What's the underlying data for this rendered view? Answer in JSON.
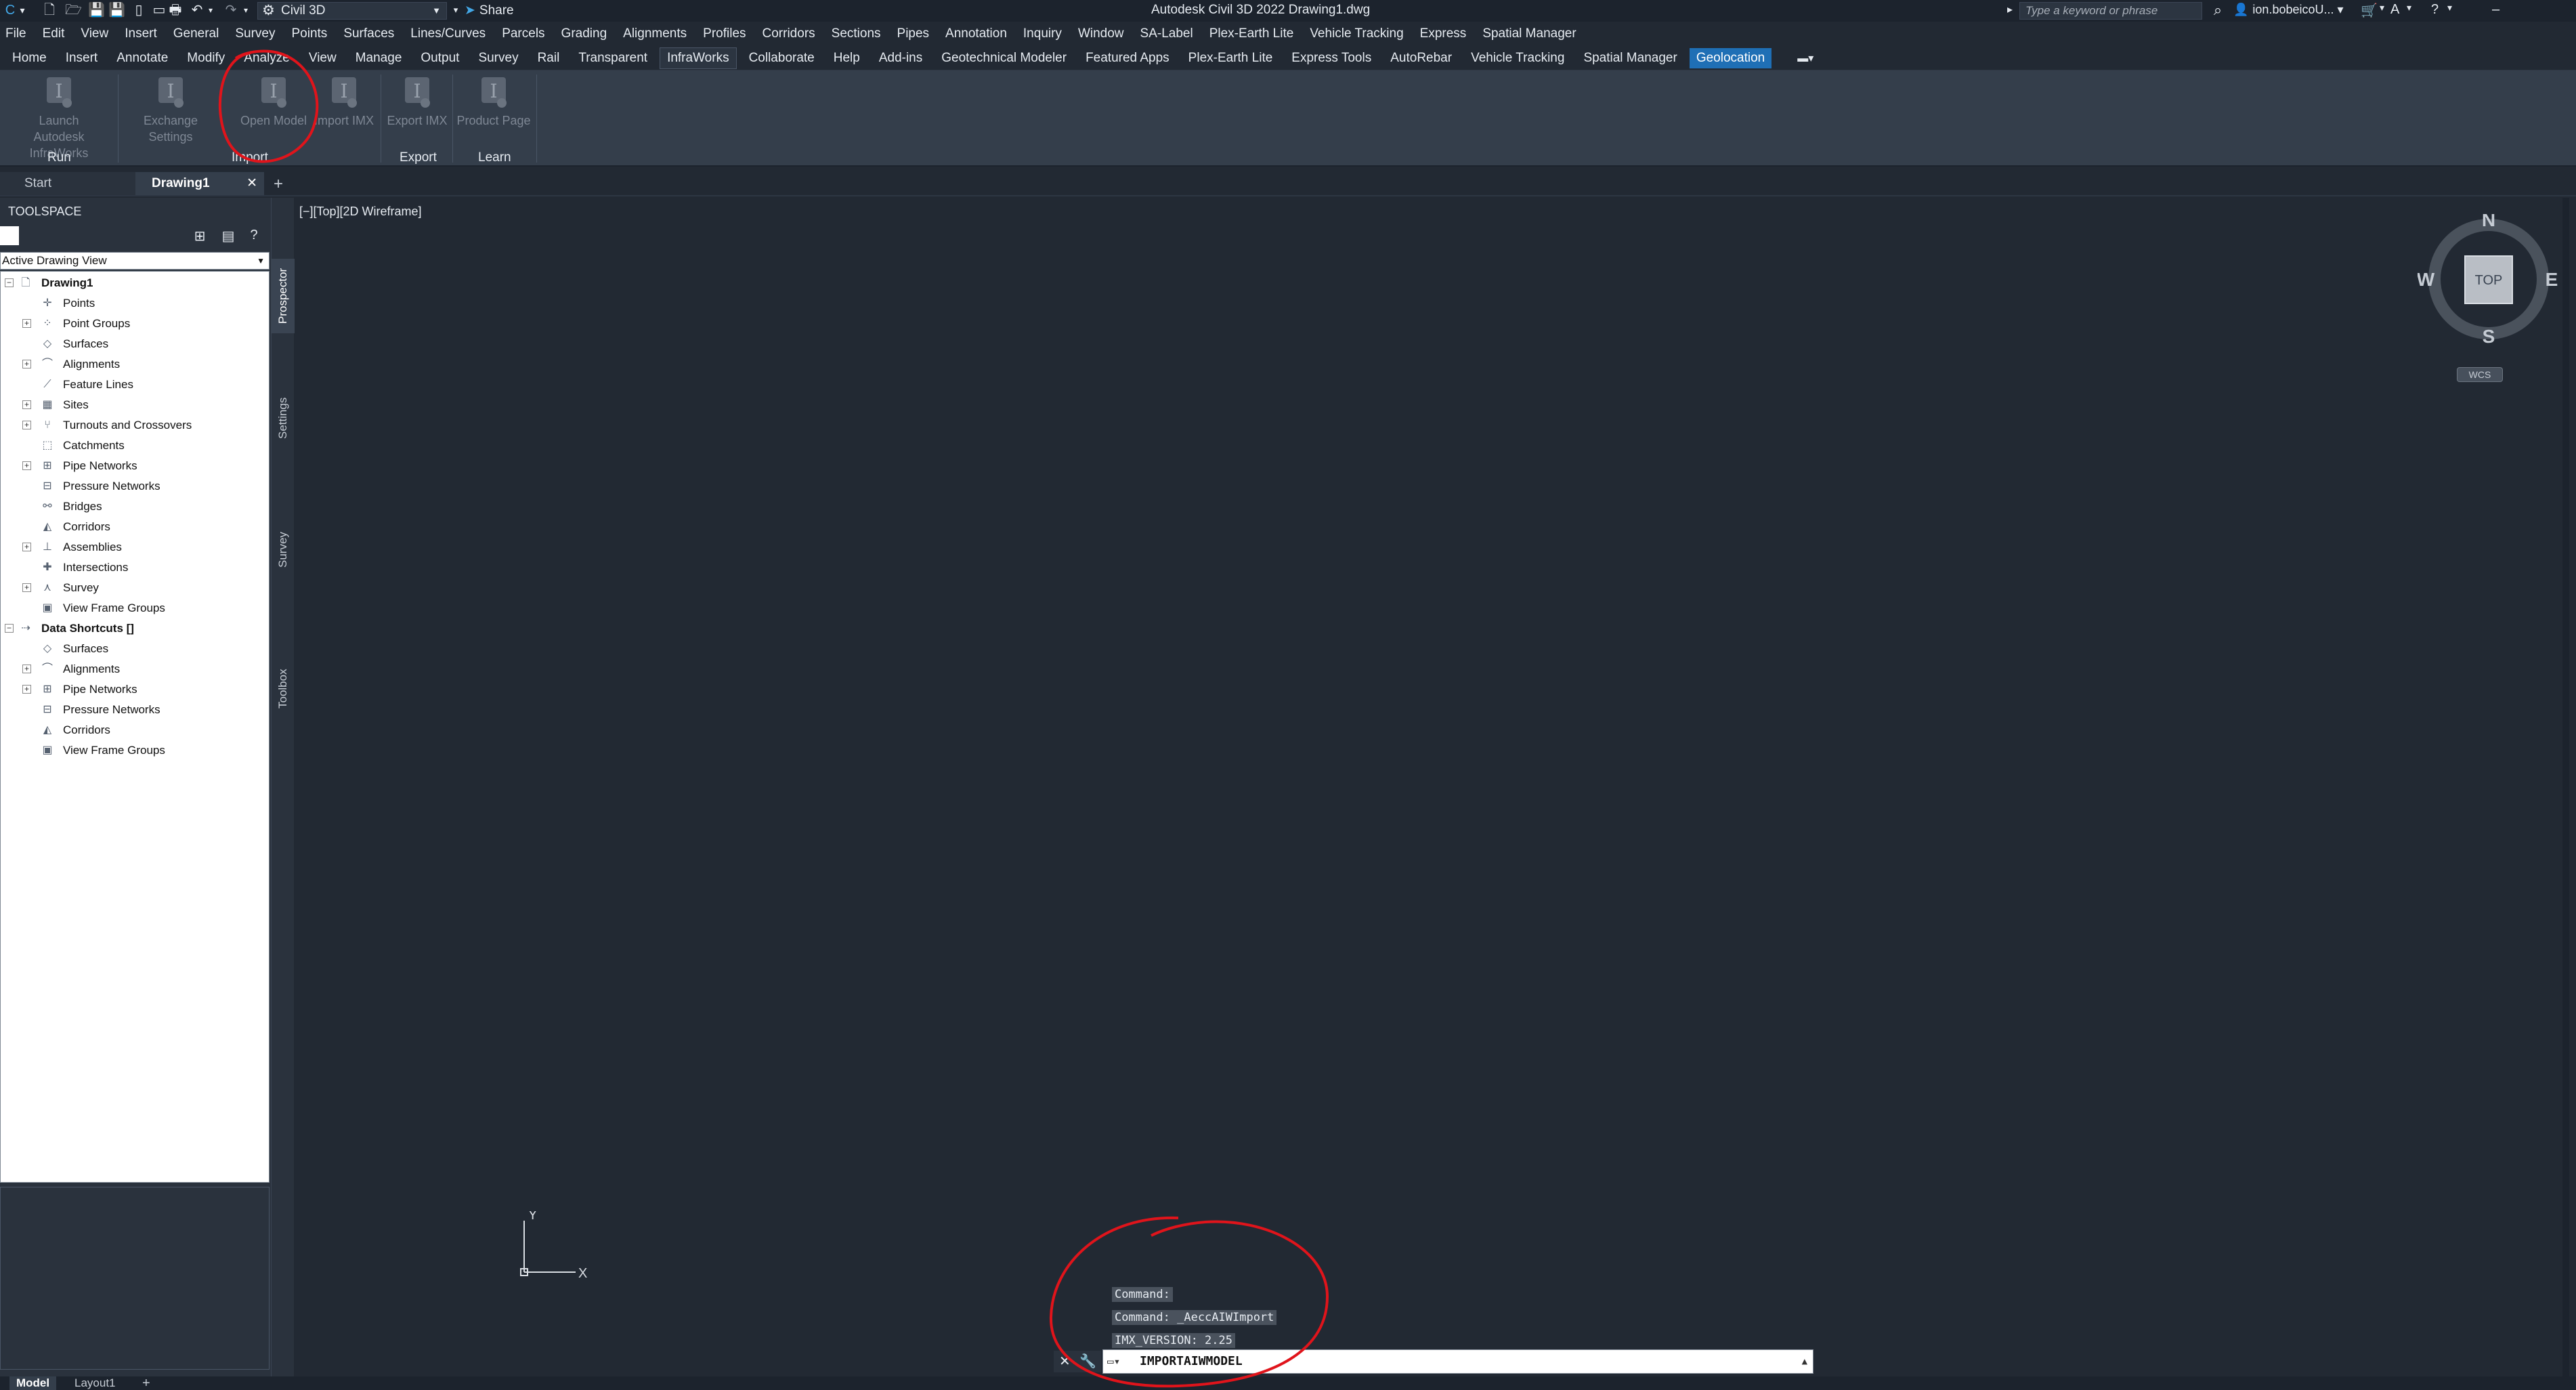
{
  "titlebar": {
    "workspace": "Civil 3D",
    "share_label": "Share",
    "app_title": "Autodesk Civil 3D 2022    Drawing1.dwg",
    "search_placeholder": "Type a keyword or phrase",
    "user_name": "ion.bobeicoU..."
  },
  "menubar": {
    "items": [
      "File",
      "Edit",
      "View",
      "Insert",
      "General",
      "Survey",
      "Points",
      "Surfaces",
      "Lines/Curves",
      "Parcels",
      "Grading",
      "Alignments",
      "Profiles",
      "Corridors",
      "Sections",
      "Pipes",
      "Annotation",
      "Inquiry",
      "Window",
      "SA-Label",
      "Plex-Earth Lite",
      "Vehicle Tracking",
      "Express",
      "Spatial Manager"
    ]
  },
  "ribbon_tabs": {
    "items": [
      "Home",
      "Insert",
      "Annotate",
      "Modify",
      "Analyze",
      "View",
      "Manage",
      "Output",
      "Survey",
      "Rail",
      "Transparent",
      "InfraWorks",
      "Collaborate",
      "Help",
      "Add-ins",
      "Geotechnical Modeler",
      "Featured Apps",
      "Plex-Earth Lite",
      "Express Tools",
      "AutoRebar",
      "Vehicle Tracking",
      "Spatial Manager",
      "Geolocation"
    ],
    "active": "InfraWorks"
  },
  "ribbon": {
    "launch_line1": "Launch",
    "launch_line2": "Autodesk InfraWorks",
    "exchange_settings": "Exchange Settings",
    "open_model": "Open Model",
    "import_imx": "Import IMX",
    "export_imx": "Export IMX",
    "product_page": "Product Page",
    "group_run": "Run",
    "group_import": "Import",
    "group_export": "Export",
    "group_learn": "Learn"
  },
  "file_tabs": {
    "start": "Start",
    "drawing": "Drawing1"
  },
  "toolspace": {
    "title": "TOOLSPACE",
    "view_select": "Active Drawing View",
    "tabs": [
      "Prospector",
      "Settings",
      "Survey",
      "Toolbox"
    ],
    "tree": [
      {
        "label": "Drawing1",
        "level": 0,
        "expander": "minus",
        "icon": "drawing-icon"
      },
      {
        "label": "Points",
        "level": 1,
        "expander": "",
        "icon": "points-icon"
      },
      {
        "label": "Point Groups",
        "level": 1,
        "expander": "plus",
        "icon": "point-groups-icon"
      },
      {
        "label": "Surfaces",
        "level": 1,
        "expander": "",
        "icon": "surfaces-icon"
      },
      {
        "label": "Alignments",
        "level": 1,
        "expander": "plus",
        "icon": "alignments-icon"
      },
      {
        "label": "Feature Lines",
        "level": 1,
        "expander": "",
        "icon": "feature-lines-icon"
      },
      {
        "label": "Sites",
        "level": 1,
        "expander": "plus",
        "icon": "sites-icon"
      },
      {
        "label": "Turnouts and Crossovers",
        "level": 1,
        "expander": "plus",
        "icon": "turnouts-icon"
      },
      {
        "label": "Catchments",
        "level": 1,
        "expander": "",
        "icon": "catchments-icon"
      },
      {
        "label": "Pipe Networks",
        "level": 1,
        "expander": "plus",
        "icon": "pipe-networks-icon"
      },
      {
        "label": "Pressure Networks",
        "level": 1,
        "expander": "",
        "icon": "pressure-networks-icon"
      },
      {
        "label": "Bridges",
        "level": 1,
        "expander": "",
        "icon": "bridges-icon"
      },
      {
        "label": "Corridors",
        "level": 1,
        "expander": "",
        "icon": "corridors-icon"
      },
      {
        "label": "Assemblies",
        "level": 1,
        "expander": "plus",
        "icon": "assemblies-icon"
      },
      {
        "label": "Intersections",
        "level": 1,
        "expander": "",
        "icon": "intersections-icon"
      },
      {
        "label": "Survey",
        "level": 1,
        "expander": "plus",
        "icon": "survey-icon"
      },
      {
        "label": "View Frame Groups",
        "level": 1,
        "expander": "",
        "icon": "view-frame-groups-icon"
      },
      {
        "label": "Data Shortcuts []",
        "level": 0,
        "expander": "minus",
        "icon": "data-shortcuts-icon"
      },
      {
        "label": "Surfaces",
        "level": 1,
        "expander": "",
        "icon": "surfaces-icon"
      },
      {
        "label": "Alignments",
        "level": 1,
        "expander": "plus",
        "icon": "alignments-icon"
      },
      {
        "label": "Pipe Networks",
        "level": 1,
        "expander": "plus",
        "icon": "pipe-networks-icon"
      },
      {
        "label": "Pressure Networks",
        "level": 1,
        "expander": "",
        "icon": "pressure-networks-icon"
      },
      {
        "label": "Corridors",
        "level": 1,
        "expander": "",
        "icon": "corridors-icon"
      },
      {
        "label": "View Frame Groups",
        "level": 1,
        "expander": "",
        "icon": "view-frame-groups-icon"
      }
    ]
  },
  "viewport": {
    "label": "[−][Top][2D Wireframe]",
    "compass_n": "N",
    "compass_s": "S",
    "compass_e": "E",
    "compass_w": "W",
    "cube_face": "TOP",
    "wcs": "WCS",
    "ucs_x": "X",
    "ucs_y": "Y"
  },
  "command": {
    "history": [
      "Command:",
      "Command: _AeccAIWImport",
      "IMX_VERSION: 2.25"
    ],
    "input_value": "IMPORTAIWMODEL"
  },
  "layout_tabs": {
    "model": "Model",
    "layout1": "Layout1"
  },
  "colors": {
    "background": "#222933",
    "ribbon": "#343e4b",
    "accent": "#1f6fb5",
    "annotation": "#e0141b"
  }
}
